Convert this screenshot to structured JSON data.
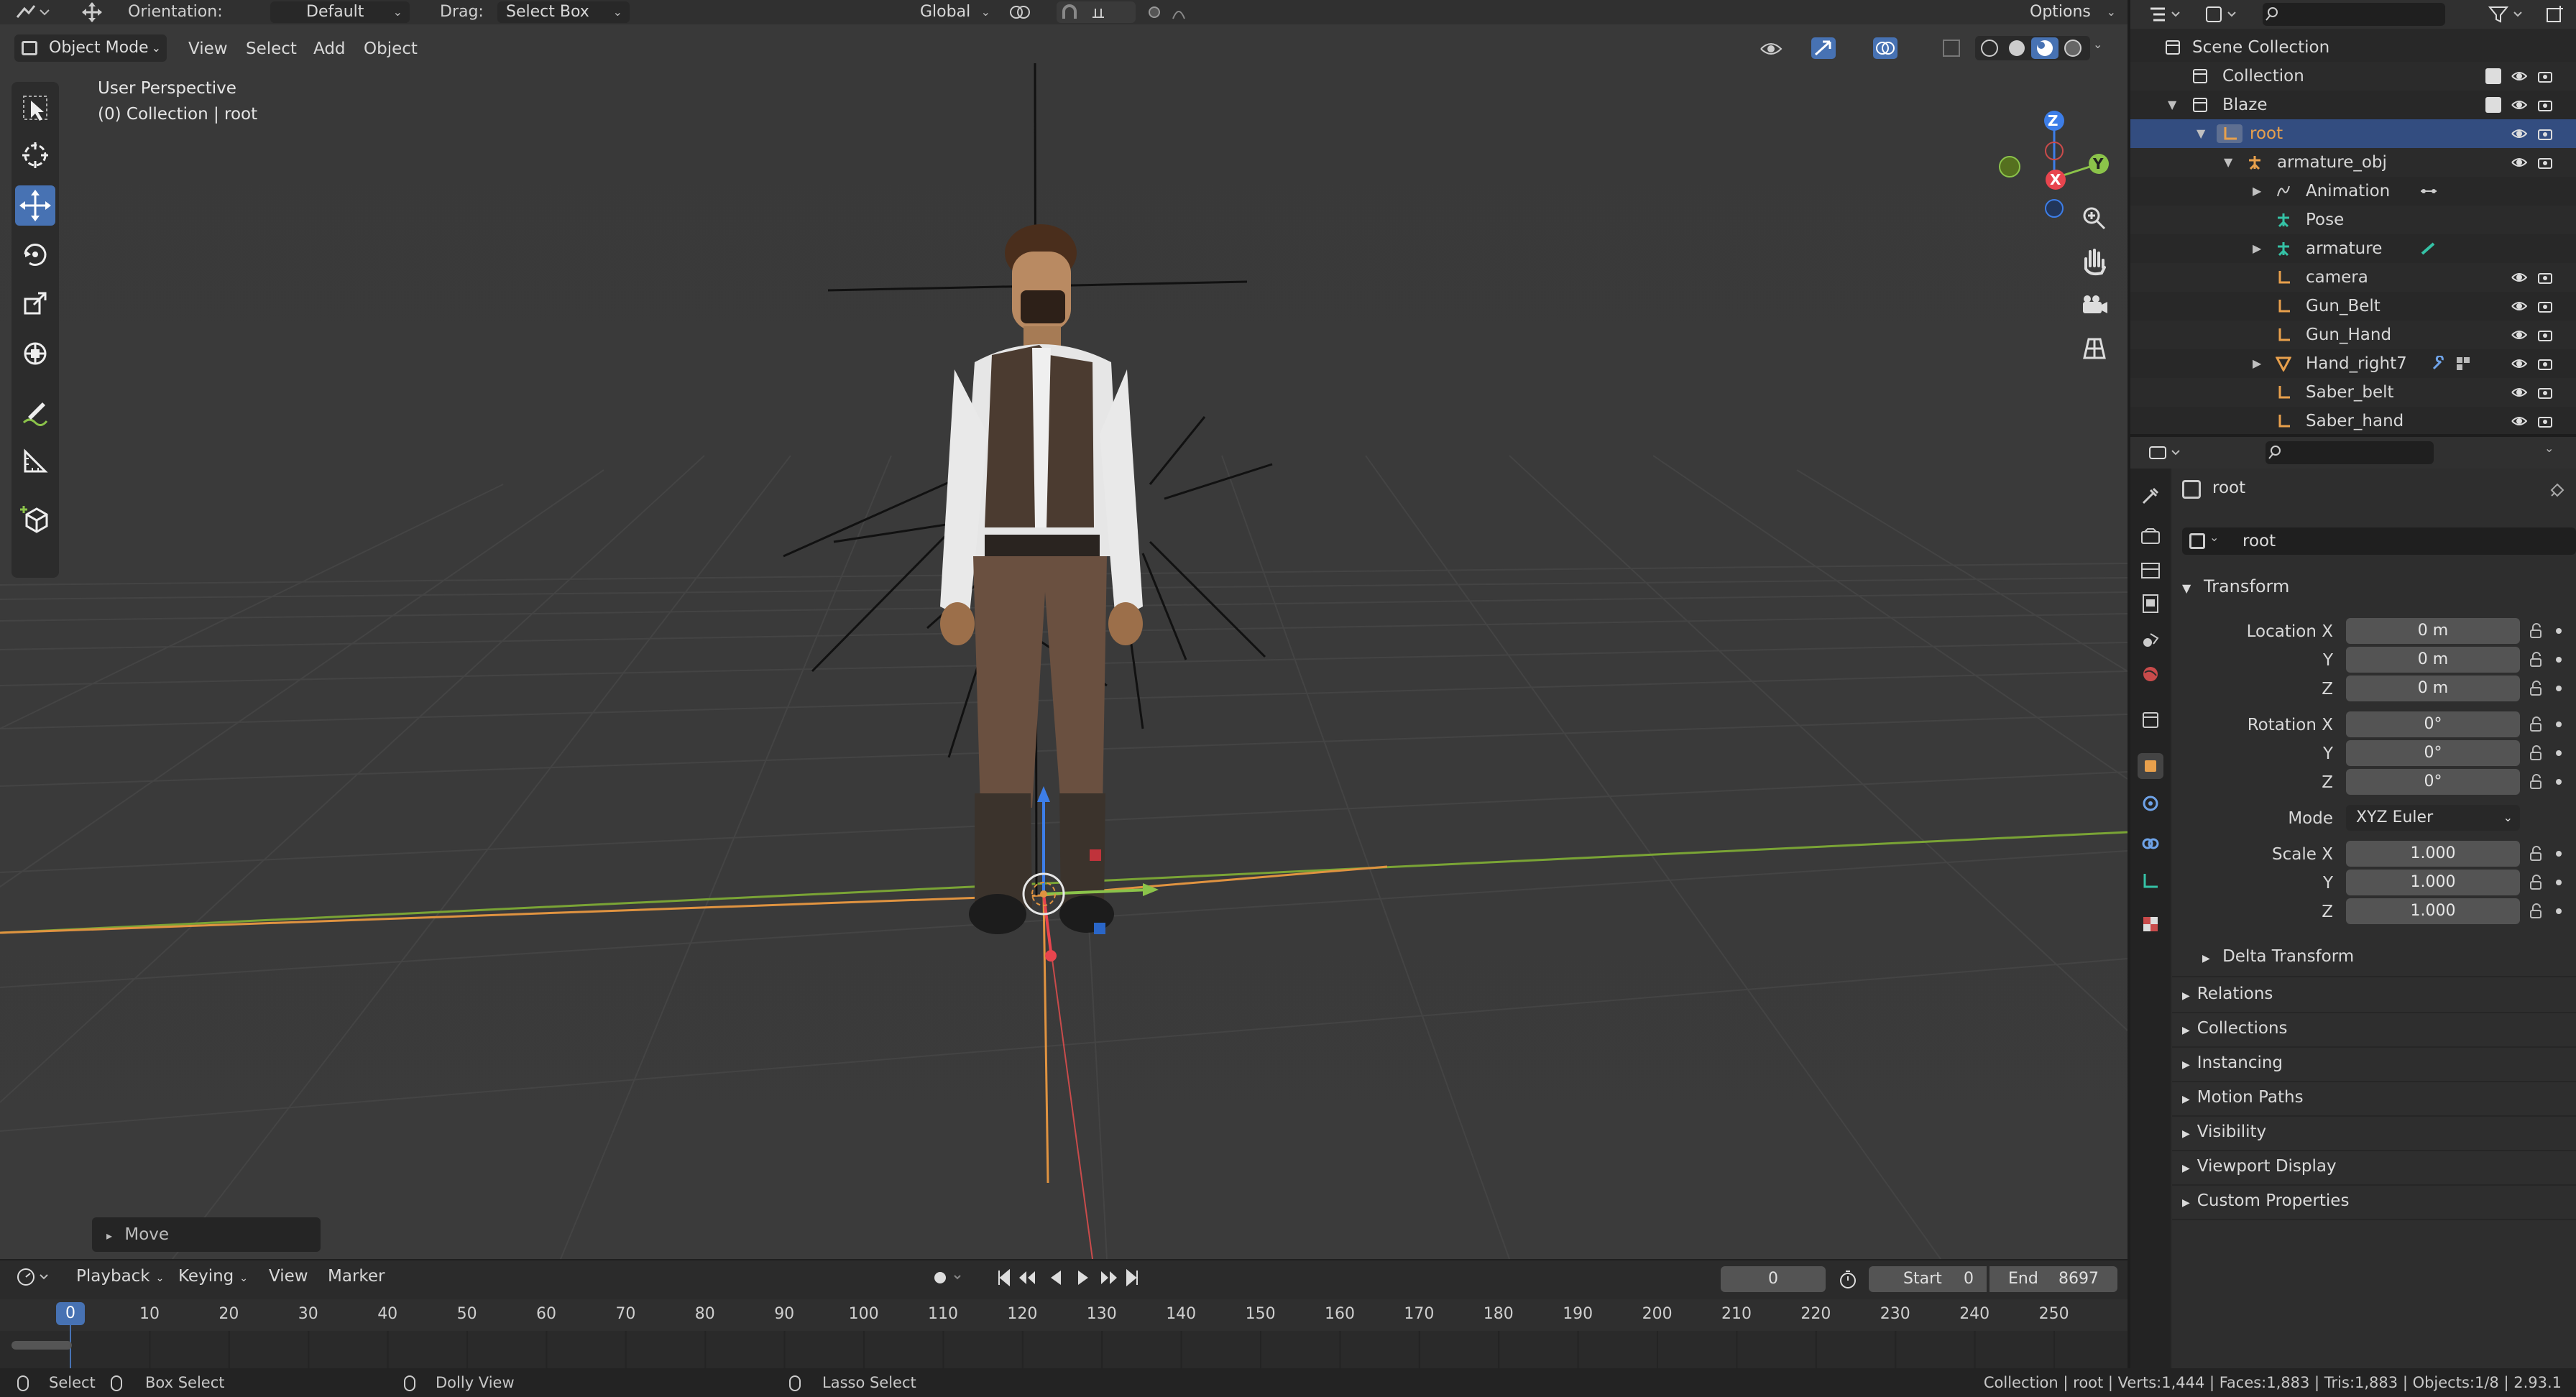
{
  "top_header": {
    "orientation_label": "Orientation:",
    "orientation_value": "Default",
    "drag_label": "Drag:",
    "drag_value": "Select Box",
    "transform_space": "Global",
    "options_label": "Options"
  },
  "viewport": {
    "mode": "Object Mode",
    "menus": [
      "View",
      "Select",
      "Add",
      "Object"
    ],
    "perspective_label": "User Perspective",
    "collection_label": "(0) Collection | root",
    "gizmo_axes": {
      "z": "Z",
      "y": "Y",
      "x": "X"
    },
    "last_operator": "Move"
  },
  "timeline": {
    "menus": [
      "Playback",
      "Keying",
      "View",
      "Marker"
    ],
    "current_frame": "0",
    "start_label": "Start",
    "start_value": "0",
    "end_label": "End",
    "end_value": "8697",
    "playhead": "0",
    "ruler": [
      "10",
      "20",
      "30",
      "40",
      "50",
      "60",
      "70",
      "80",
      "90",
      "100",
      "110",
      "120",
      "130",
      "140",
      "150",
      "160",
      "170",
      "180",
      "190",
      "200",
      "210",
      "220",
      "230",
      "240",
      "250"
    ]
  },
  "status_bar": {
    "select": "Select",
    "box_select": "Box Select",
    "dolly_view": "Dolly View",
    "lasso_select": "Lasso Select",
    "stats": "Collection | root | Verts:1,444 | Faces:1,883 | Tris:1,883 | Objects:1/8 | 2.93.1"
  },
  "outliner": {
    "rows": [
      {
        "label": "Scene Collection"
      },
      {
        "label": "Collection"
      },
      {
        "label": "Blaze"
      },
      {
        "label": "root"
      },
      {
        "label": "armature_obj"
      },
      {
        "label": "Animation"
      },
      {
        "label": "Pose"
      },
      {
        "label": "armature"
      },
      {
        "label": "camera"
      },
      {
        "label": "Gun_Belt"
      },
      {
        "label": "Gun_Hand"
      },
      {
        "label": "Hand_right7"
      },
      {
        "label": "Saber_belt"
      },
      {
        "label": "Saber_hand"
      }
    ]
  },
  "properties": {
    "object_name": "root",
    "datablock_name": "root",
    "transform_label": "Transform",
    "location": {
      "label_x": "Location X",
      "label_y": "Y",
      "label_z": "Z",
      "x": "0 m",
      "y": "0 m",
      "z": "0 m"
    },
    "rotation": {
      "label_x": "Rotation X",
      "label_y": "Y",
      "label_z": "Z",
      "x": "0°",
      "y": "0°",
      "z": "0°"
    },
    "mode_label": "Mode",
    "mode_value": "XYZ Euler",
    "scale": {
      "label_x": "Scale X",
      "label_y": "Y",
      "label_z": "Z",
      "x": "1.000",
      "y": "1.000",
      "z": "1.000"
    },
    "delta_transform": "Delta Transform",
    "sections": [
      "Relations",
      "Collections",
      "Instancing",
      "Motion Paths",
      "Visibility",
      "Viewport Display",
      "Custom Properties"
    ]
  },
  "colors": {
    "accent": "#4772b3",
    "selected_row": "#334d80",
    "axis_x": "#e8454e",
    "axis_y": "#8bc34a",
    "axis_z": "#3d7ee8",
    "object_orange": "#e8a04c"
  }
}
